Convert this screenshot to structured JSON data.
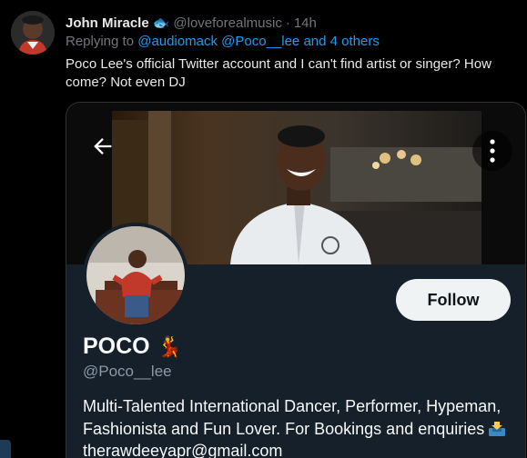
{
  "tweet": {
    "author_name": "John Miracle",
    "author_emoji": "🐟",
    "handle": "@loveforealmusic",
    "separator": "·",
    "time": "14h",
    "reply_prefix": "Replying to ",
    "reply_mentions": "@audiomack @Poco__lee and 4 others",
    "text": "Poco Lee's official Twitter account and I can't find artist or singer? How come? Not even DJ"
  },
  "profile": {
    "name": "POCO",
    "name_emoji": "💃",
    "handle": "@Poco__lee",
    "follow_label": "Follow",
    "bio_main": "Multi-Talented International Dancer, Performer, Hypeman, Fashionista and Fun Lover. For Bookings and enquiries ",
    "bio_email": " therawdeeyapr@gmail.com"
  },
  "icons": {
    "back": "arrow-left-icon",
    "more": "vertical-dots-icon",
    "inbox": "inbox-tray-icon"
  },
  "colors": {
    "background": "#000000",
    "card_background": "#15202b",
    "link": "#1d9bf0",
    "secondary_text": "#71767b",
    "follow_button": "#eff3f4"
  }
}
